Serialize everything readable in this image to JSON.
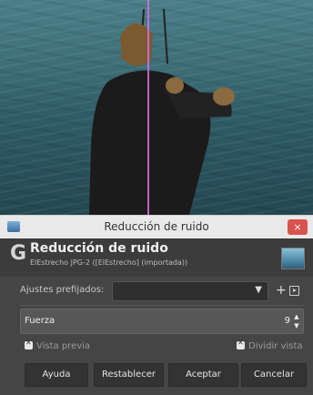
{
  "window": {
    "title": "Reducción de ruido",
    "close_label": "×"
  },
  "dialog": {
    "logo": "G",
    "title": "Reducción de ruido",
    "subtitle": "ElEstrecho JPG-2 ([ElEstrecho] (importada))"
  },
  "presets": {
    "label": "Ajustes prefijados:",
    "selected": "",
    "add": "+"
  },
  "strength": {
    "label": "Fuerza",
    "value": "9"
  },
  "options": {
    "preview": "Vista previa",
    "split_view": "Dividir vista"
  },
  "buttons": {
    "help": "Ayuda",
    "reset": "Restablecer",
    "ok": "Aceptar",
    "cancel": "Cancelar"
  },
  "colors": {
    "accent_close": "#d9534f",
    "split_line": "#e06be0",
    "dialog_bg": "#454545"
  }
}
